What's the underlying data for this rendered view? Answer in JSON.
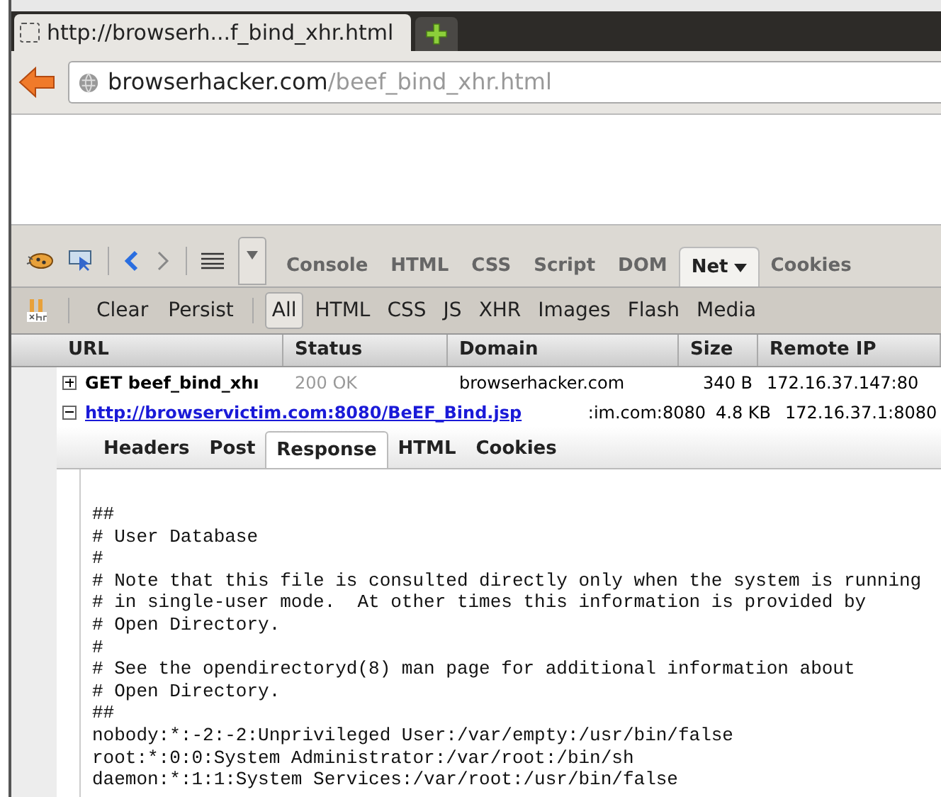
{
  "browser": {
    "tab_title": "http://browserh...f_bind_xhr.html",
    "url_host": "browserhacker.com",
    "url_path": "/beef_bind_xhr.html"
  },
  "panel_tabs": [
    {
      "label": "Console",
      "selected": false,
      "menu": false
    },
    {
      "label": "HTML",
      "selected": false,
      "menu": false
    },
    {
      "label": "CSS",
      "selected": false,
      "menu": false
    },
    {
      "label": "Script",
      "selected": false,
      "menu": false
    },
    {
      "label": "DOM",
      "selected": false,
      "menu": false
    },
    {
      "label": "Net",
      "selected": true,
      "menu": true
    },
    {
      "label": "Cookies",
      "selected": false,
      "menu": false
    }
  ],
  "net_actions": [
    "Clear",
    "Persist"
  ],
  "filters": [
    {
      "label": "All",
      "selected": true
    },
    {
      "label": "HTML",
      "selected": false
    },
    {
      "label": "CSS",
      "selected": false
    },
    {
      "label": "JS",
      "selected": false
    },
    {
      "label": "XHR",
      "selected": false
    },
    {
      "label": "Images",
      "selected": false
    },
    {
      "label": "Flash",
      "selected": false
    },
    {
      "label": "Media",
      "selected": false
    }
  ],
  "table": {
    "columns": [
      "URL",
      "Status",
      "Domain",
      "Size",
      "Remote IP"
    ],
    "rows": [
      {
        "expanded": false,
        "kind": "request",
        "url": "GET beef_bind_xhı",
        "status": "200 OK",
        "domain": "browserhacker.com",
        "size": "340 B",
        "remote_ip": "172.16.37.147:80"
      },
      {
        "expanded": true,
        "kind": "link",
        "url": "http://browservictim.com:8080/BeEF_Bind.jsp",
        "domain": ":im.com:8080",
        "size": "4.8 KB",
        "remote_ip": "172.16.37.1:8080"
      }
    ]
  },
  "detail_tabs": [
    {
      "label": "Headers",
      "selected": false
    },
    {
      "label": "Post",
      "selected": false
    },
    {
      "label": "Response",
      "selected": true
    },
    {
      "label": "HTML",
      "selected": false
    },
    {
      "label": "Cookies",
      "selected": false
    }
  ],
  "response_lines": [
    "##",
    "# User Database",
    "#",
    "# Note that this file is consulted directly only when the system is running",
    "# in single-user mode.  At other times this information is provided by",
    "# Open Directory.",
    "#",
    "# See the opendirectoryd(8) man page for additional information about",
    "# Open Directory.",
    "##",
    "nobody:*:-2:-2:Unprivileged User:/var/empty:/usr/bin/false",
    "root:*:0:0:System Administrator:/var/root:/bin/sh",
    "daemon:*:1:1:System Services:/var/root:/usr/bin/false"
  ]
}
